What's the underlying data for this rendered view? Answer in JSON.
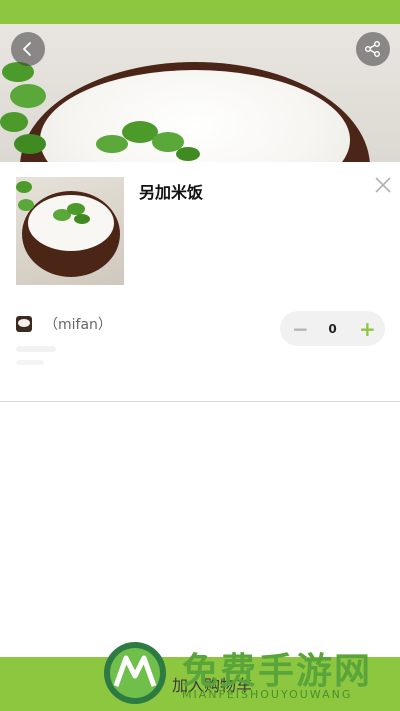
{
  "header": {
    "back_icon": "chevron-left-icon",
    "share_icon": "share-icon"
  },
  "product": {
    "title": "另加米饭",
    "close_icon": "close-icon",
    "spec_label": "（mifan）",
    "quantity": "0",
    "minus_symbol": "−",
    "plus_symbol": "+"
  },
  "footer": {
    "cart_label": "加入购物车"
  },
  "watermark": {
    "text": "免费手游网",
    "subtext": "MIANFEISHOUYOUWANG"
  },
  "colors": {
    "accent": "#8dc63f",
    "disabled": "#b5b5b5"
  }
}
